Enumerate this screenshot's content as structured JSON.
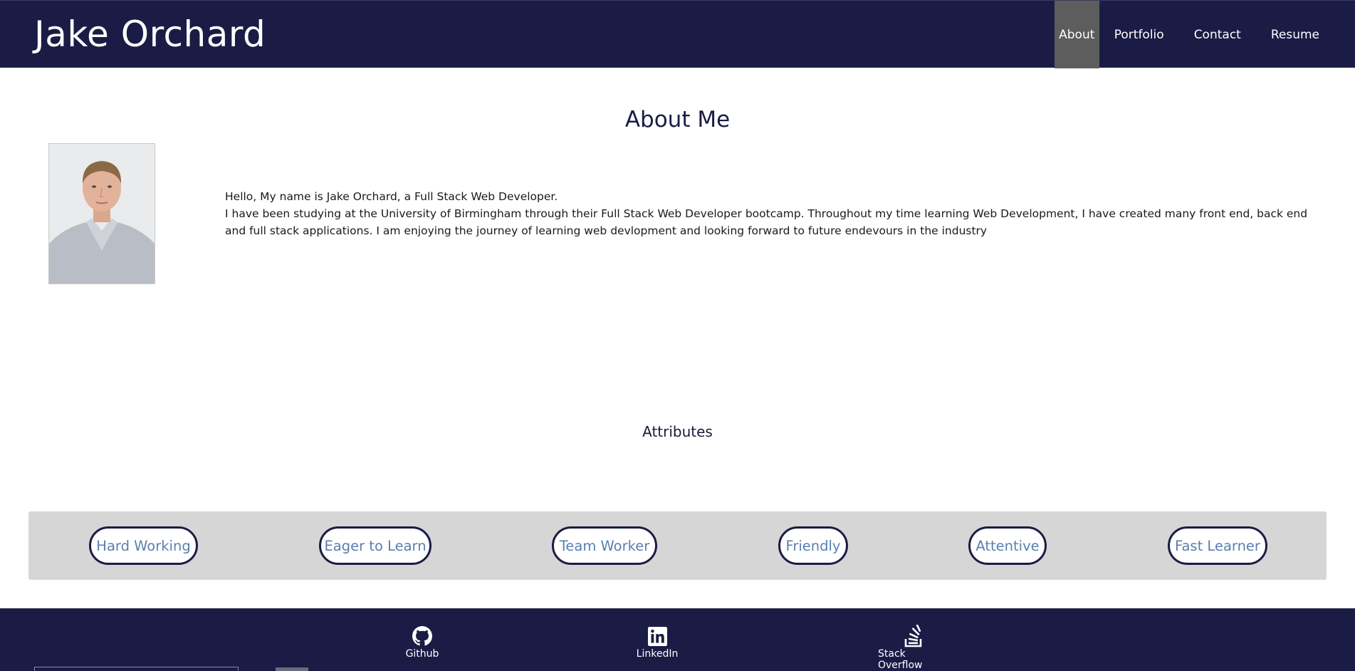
{
  "header": {
    "title": "Jake Orchard",
    "nav": [
      {
        "label": "About",
        "active": true
      },
      {
        "label": "Portfolio",
        "active": false
      },
      {
        "label": "Contact",
        "active": false
      },
      {
        "label": "Resume",
        "active": false
      }
    ]
  },
  "about": {
    "heading": "About Me",
    "photo_icon": "profile-photo",
    "intro": "Hello, My name is Jake Orchard, a Full Stack Web Developer.",
    "body": "I have been studying at the University of Birmingham through their Full Stack Web Developer bootcamp. Throughout my time learning Web Development, I have created many front end, back end and full stack applications. I am enjoying the journey of learning web devlopment and looking forward to future endevours in the industry"
  },
  "attributes": {
    "heading": "Attributes",
    "items": [
      "Hard Working",
      "Eager to Learn",
      "Team Worker",
      "Friendly",
      "Attentive",
      "Fast Learner"
    ]
  },
  "footer": {
    "links": [
      {
        "label": "Github",
        "icon": "github-icon"
      },
      {
        "label": "LinkedIn",
        "icon": "linkedin-icon"
      },
      {
        "label": "Stack Overflow",
        "icon": "stack-overflow-icon"
      }
    ]
  },
  "colors": {
    "navy": "#1b1c45",
    "active_nav": "#5d5d5d",
    "pill_text": "#5a7fb0",
    "attr_bar": "#d6d6d6"
  }
}
